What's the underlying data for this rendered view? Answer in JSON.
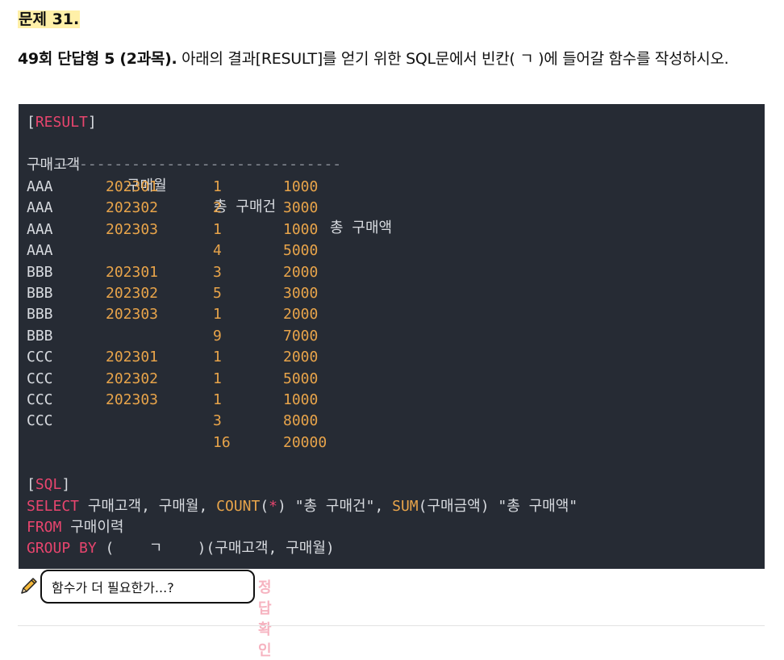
{
  "problem": {
    "title": "문제 31.",
    "source": "49회 단답형 5 (2과목).",
    "text": " 아래의 결과[RESULT]를 얻기 위한 SQL문에서 빈칸(  ㄱ  )에 들어갈 함수를 작성하시오."
  },
  "result": {
    "label_open": "[",
    "label": "RESULT",
    "label_close": "]",
    "headers": [
      "구매고객",
      "구매월",
      "총 구매건",
      "총 구매액"
    ],
    "separator": "------------------------------------",
    "rows": [
      [
        "AAA",
        "202301",
        "1",
        "1000"
      ],
      [
        "AAA",
        "202302",
        "2",
        "3000"
      ],
      [
        "AAA",
        "202303",
        "1",
        "1000"
      ],
      [
        "AAA",
        "",
        "4",
        "5000"
      ],
      [
        "BBB",
        "202301",
        "3",
        "2000"
      ],
      [
        "BBB",
        "202302",
        "5",
        "3000"
      ],
      [
        "BBB",
        "202303",
        "1",
        "2000"
      ],
      [
        "BBB",
        "",
        "9",
        "7000"
      ],
      [
        "CCC",
        "202301",
        "1",
        "2000"
      ],
      [
        "CCC",
        "202302",
        "1",
        "5000"
      ],
      [
        "CCC",
        "202303",
        "1",
        "1000"
      ],
      [
        "CCC",
        "",
        "3",
        "8000"
      ],
      [
        "",
        "",
        "16",
        "20000"
      ]
    ]
  },
  "sql": {
    "label_open": "[",
    "label": "SQL",
    "label_close": "]",
    "line1": {
      "kw": "SELECT",
      "a": " 구매고객, 구매월, ",
      "fn1": "COUNT",
      "p1": "(",
      "star": "*",
      "b": ") \"총 구매건\", ",
      "fn2": "SUM",
      "c": "(구매금액) \"총 구매액\""
    },
    "line2": {
      "kw": "FROM",
      "a": " 구매이력"
    },
    "line3": {
      "kw": "GROUP BY",
      "a": " (    ㄱ    )(구매고객, 구매월)"
    }
  },
  "answer": {
    "value": "함수가 더 필요한가...?",
    "check_label": "정답확인"
  },
  "colors": {
    "code_bg": "#262b34",
    "keyword": "#e8456e",
    "value": "#e8a44a",
    "highlight": "#fff0a8",
    "check_button": "#f6b3c0"
  }
}
